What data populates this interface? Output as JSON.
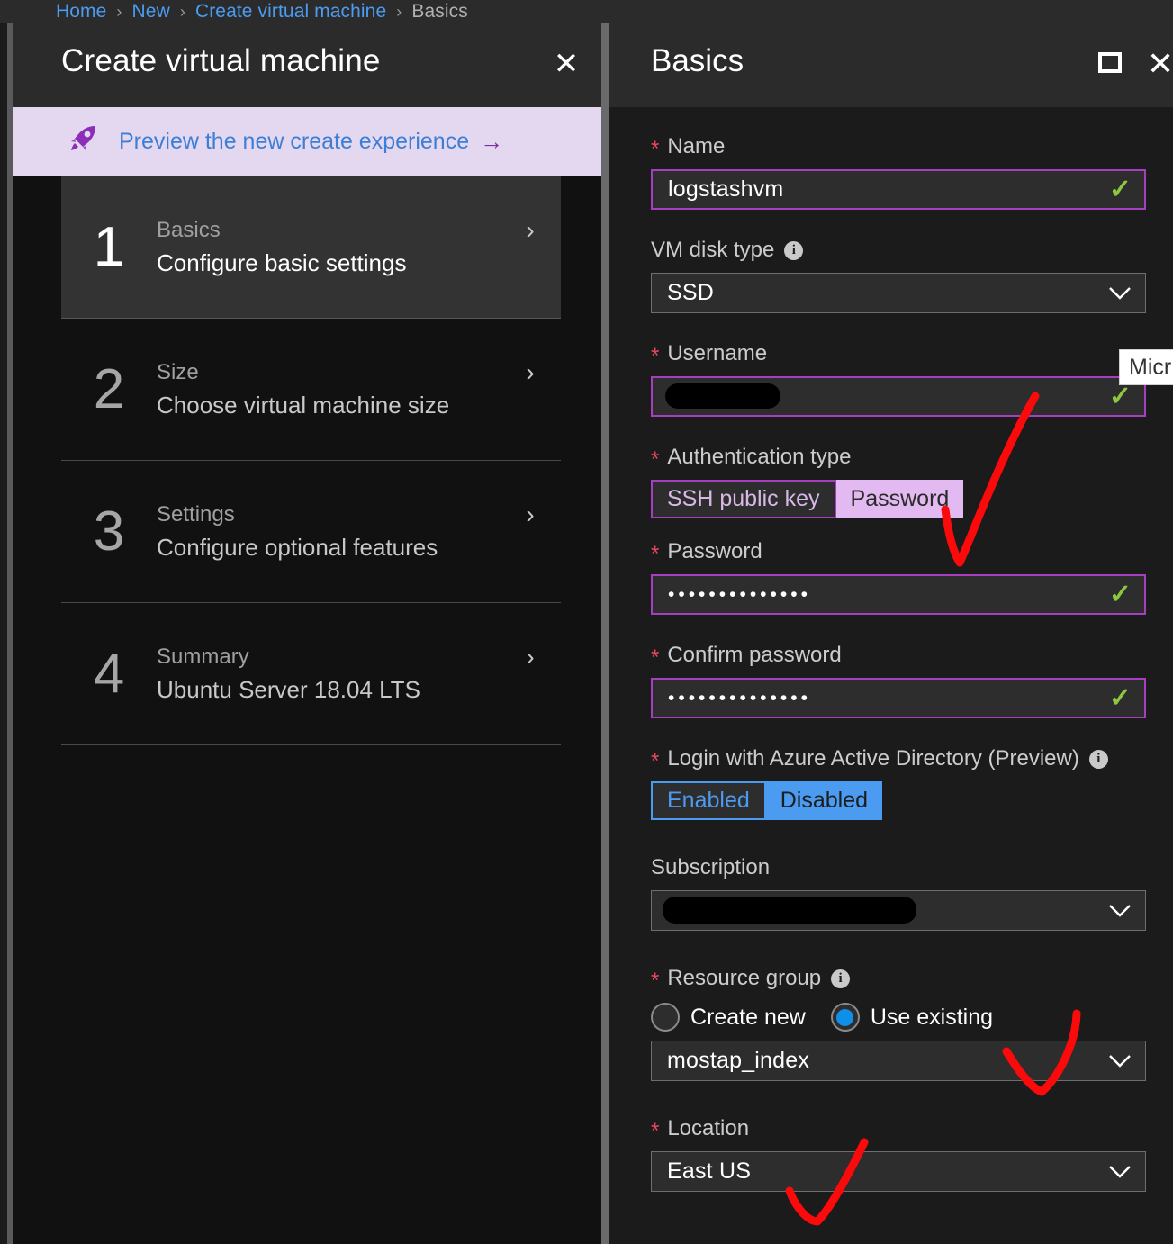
{
  "breadcrumb": {
    "items": [
      {
        "label": "Home",
        "current": false
      },
      {
        "label": "New",
        "current": false
      },
      {
        "label": "Create virtual machine",
        "current": false
      },
      {
        "label": "Basics",
        "current": true
      }
    ],
    "separator": "›"
  },
  "left_blade": {
    "title": "Create virtual machine",
    "close_label": "✕",
    "preview_banner": {
      "icon": "rocket-icon",
      "text": "Preview the new create experience",
      "arrow": "→"
    },
    "steps": [
      {
        "number": "1",
        "label": "Basics",
        "sub": "Configure basic settings",
        "selected": true,
        "chevron": "›"
      },
      {
        "number": "2",
        "label": "Size",
        "sub": "Choose virtual machine size",
        "selected": false,
        "chevron": "›"
      },
      {
        "number": "3",
        "label": "Settings",
        "sub": "Configure optional features",
        "selected": false,
        "chevron": "›"
      },
      {
        "number": "4",
        "label": "Summary",
        "sub": "Ubuntu Server 18.04 LTS",
        "selected": false,
        "chevron": "›"
      }
    ]
  },
  "right_blade": {
    "title": "Basics",
    "maximize_label": "maximize-icon",
    "close_label": "✕",
    "fields": {
      "name": {
        "label": "Name",
        "required_marker": "*",
        "value": "logstashvm",
        "valid_marker": "✓"
      },
      "vm_disk_type": {
        "label": "VM disk type",
        "info_marker": "i",
        "value": "SSD"
      },
      "username": {
        "label": "Username",
        "required_marker": "*",
        "value": "",
        "redacted": true,
        "valid_marker": "✓"
      },
      "authentication_type": {
        "label": "Authentication type",
        "required_marker": "*",
        "options": [
          "SSH public key",
          "Password"
        ],
        "selected": "Password"
      },
      "password": {
        "label": "Password",
        "required_marker": "*",
        "value": "••••••••••••••",
        "valid_marker": "✓"
      },
      "confirm_password": {
        "label": "Confirm password",
        "required_marker": "*",
        "value": "••••••••••••••",
        "valid_marker": "✓"
      },
      "aad_login": {
        "label": "Login with Azure Active Directory (Preview)",
        "required_marker": "*",
        "info_marker": "i",
        "options": [
          "Enabled",
          "Disabled"
        ],
        "selected": "Disabled"
      },
      "subscription": {
        "label": "Subscription",
        "value": "",
        "redacted": true
      },
      "resource_group": {
        "label": "Resource group",
        "required_marker": "*",
        "info_marker": "i",
        "radio_options": [
          "Create new",
          "Use existing"
        ],
        "radio_selected": "Use existing",
        "value": "mostap_index"
      },
      "location": {
        "label": "Location",
        "required_marker": "*",
        "value": "East US"
      }
    }
  },
  "tooltip": {
    "text": "Micr"
  },
  "annotations": {
    "color": "#fa0a0a",
    "marks": [
      "checkmark-authentication-type",
      "checkmark-resource-group",
      "checkmark-location"
    ]
  }
}
